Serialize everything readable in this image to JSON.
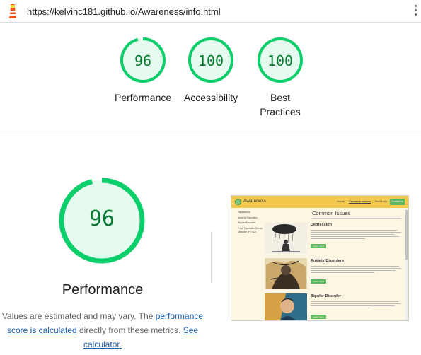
{
  "url": "https://kelvinc181.github.io/Awareness/info.html",
  "colors": {
    "pass_green": "#0cce6b",
    "pass_fill": "#e6fbef",
    "score_text": "#0a7a32",
    "link": "#1a5fb4"
  },
  "categories": [
    {
      "score": "96",
      "label": "Performance",
      "value": 96
    },
    {
      "score": "100",
      "label": "Accessibility",
      "value": 100
    },
    {
      "score": "100",
      "label": "Best Practices",
      "value": 100
    }
  ],
  "performance": {
    "score": "96",
    "value": 96,
    "title": "Performance",
    "desc_before": "Values are estimated and may vary. The ",
    "desc_link1": "performance score is calculated",
    "desc_middle": " directly from these metrics. ",
    "desc_link2": "See calculator."
  },
  "thumbnail": {
    "brand": "Awareness",
    "nav": [
      "Home",
      "Common issues",
      "Find Help"
    ],
    "nav_button": "Contact us",
    "sidebar": [
      "Depression",
      "Anxiety Disorders",
      "Bipolar Disorder",
      "Post-Traumatic Stress Disorder (PTSD)"
    ],
    "heading": "Common Issues",
    "sections": [
      {
        "title": "Depression",
        "button": "Learn more"
      },
      {
        "title": "Anxiety Disorders",
        "button": "Learn more"
      },
      {
        "title": "Bipolar Disorder",
        "button": "Learn more"
      }
    ]
  }
}
